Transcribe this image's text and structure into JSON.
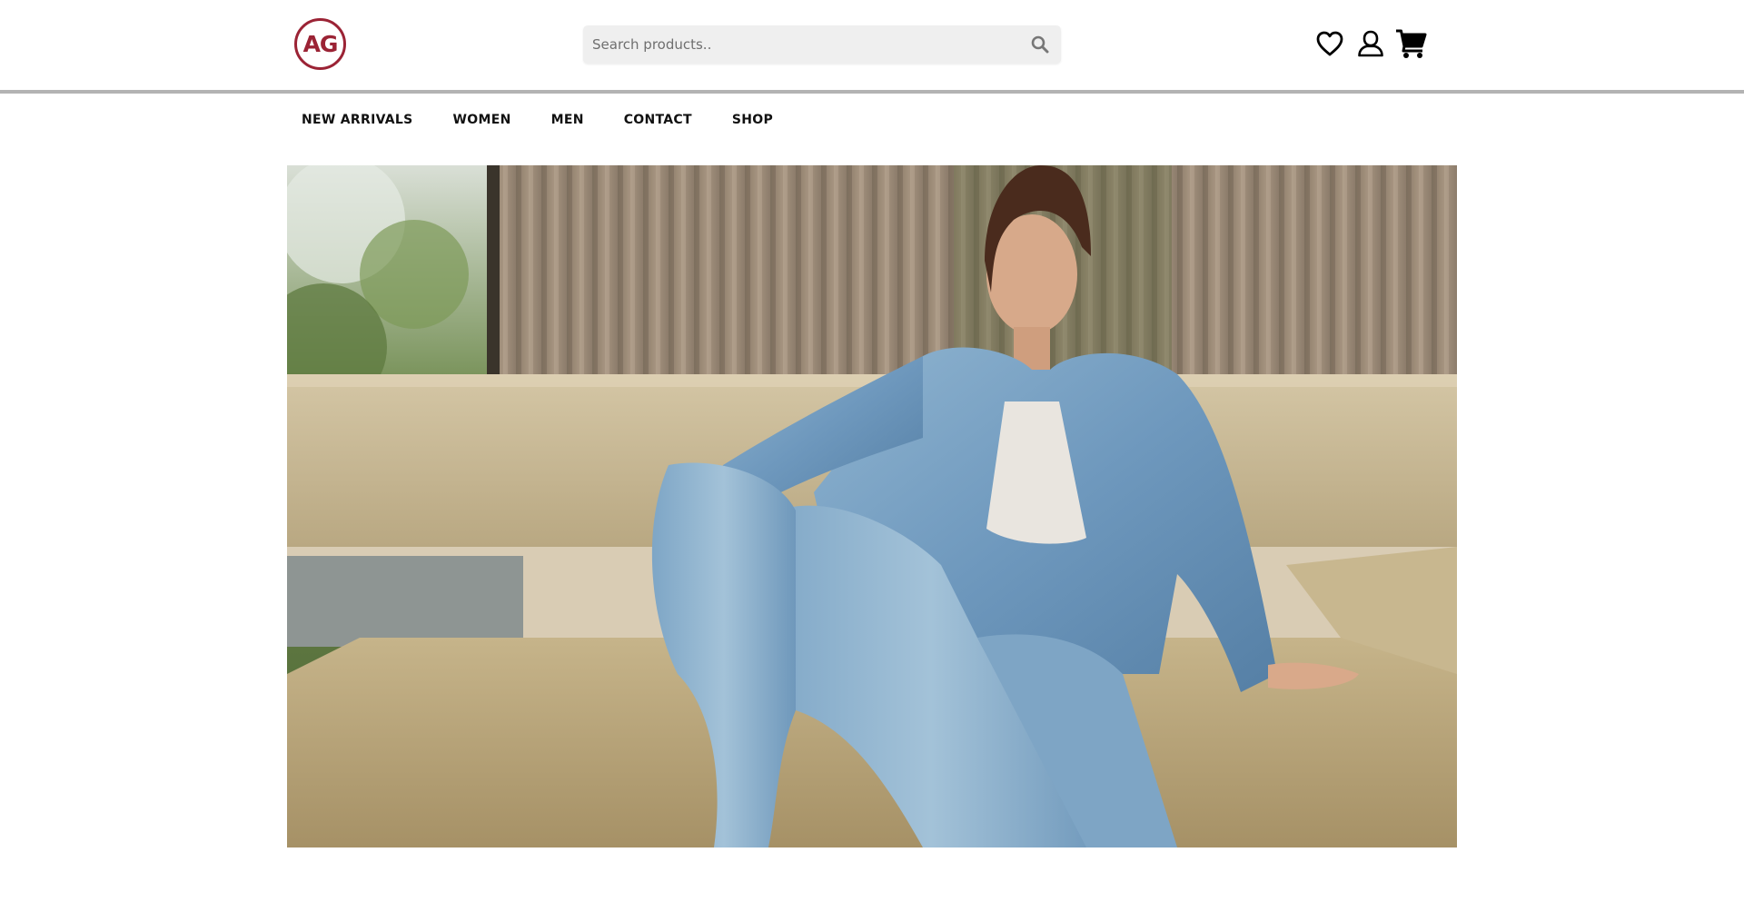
{
  "header": {
    "logo_text": "AG",
    "brand_color": "#9b2335",
    "search": {
      "placeholder": "Search products..",
      "value": "",
      "icon": "search-icon"
    },
    "icons": [
      "heart-icon",
      "user-icon",
      "cart-icon"
    ]
  },
  "nav": {
    "items": [
      {
        "label": "NEW ARRIVALS"
      },
      {
        "label": "WOMEN"
      },
      {
        "label": "MEN"
      },
      {
        "label": "CONTACT"
      },
      {
        "label": "SHOP"
      }
    ]
  },
  "hero": {
    "image": "photo-woman-in-denim-jacket-and-jeans-on-sofa"
  }
}
